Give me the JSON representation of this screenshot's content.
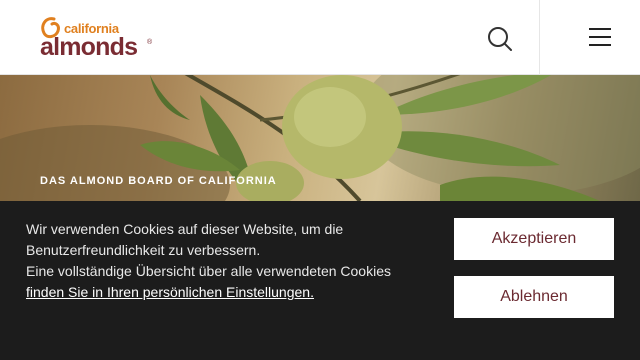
{
  "header": {
    "logo_small": "california",
    "logo_big": "almonds",
    "logo_reg": "®",
    "search_icon": "search-icon",
    "menu_icon": "hamburger-menu-icon"
  },
  "hero": {
    "eyebrow": "DAS ALMOND BOARD OF CALIFORNIA"
  },
  "cookie_banner": {
    "line1": "Wir verwenden Cookies auf dieser Website, um die Benutzerfreundlichkeit zu verbessern.",
    "line2": "Eine vollständige Übersicht über alle verwendeten Cookies",
    "link": "finden Sie in Ihren persönlichen Einstellungen.",
    "accept_label": "Akzeptieren",
    "decline_label": "Ablehnen"
  },
  "colors": {
    "brand_maroon": "#7a2c33",
    "brand_orange": "#e0801f",
    "banner_bg": "#1c1c1c"
  }
}
